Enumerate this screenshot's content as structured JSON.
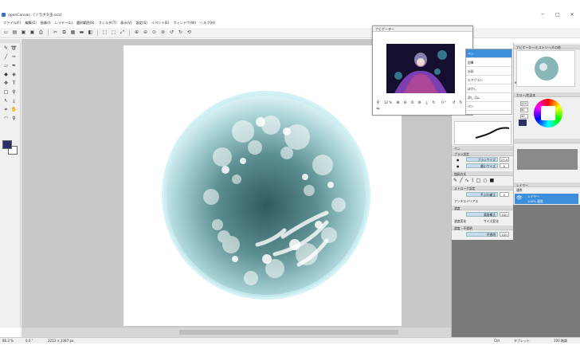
{
  "window": {
    "title": "openCanvas - [ソラボタ玉.ocz]",
    "minimize": "─",
    "maximize": "□",
    "close": "✕"
  },
  "menu": [
    "ファイル(F)",
    "編集(E)",
    "画像(I)",
    "レイヤー(L)",
    "選択範囲(S)",
    "フィルタ(T)",
    "表示(V)",
    "設定(S)",
    "イベント(E)",
    "ウィンドウ(W)",
    "ヘルプ(H)"
  ],
  "toolbar": {
    "icons": [
      "new-file-icon",
      "open-icon",
      "save-icon",
      "save-as-icon",
      "print-icon",
      "cut-icon",
      "copy-icon",
      "paste-icon",
      "delete-icon",
      "fill-icon",
      "select-all-icon",
      "deselect-icon",
      "transform-icon",
      "zoom-in-icon",
      "zoom-out-icon",
      "zoom-fit-icon",
      "zoom-actual-icon",
      "rotate-left-icon",
      "rotate-right-icon",
      "reset-rotation-icon"
    ]
  },
  "navigator": {
    "title": "ナビゲーター",
    "zoom": "12 %",
    "rotation": "0 °"
  },
  "tool_property": {
    "title": "ペン",
    "brush_section": "ブラシ設定",
    "size_label": "ブラシサイズ",
    "size_value": "27.0",
    "min_size_label": "最小サイズ",
    "min_size_value": "0",
    "shape_section": "描画方式",
    "stroke_section": "ストローク設定",
    "stroke_label": "手ぶれ補正",
    "stroke_value": "0",
    "antialias": "アンチエイリアス",
    "density_section": "濃度",
    "density_label": "濃度補正",
    "density_value": "100",
    "density_toggle": "濃度変化",
    "size_toggle": "サイズ変化",
    "opacity_section": "濃度・不透明",
    "opacity_label": "不透明",
    "opacity_value": "100"
  },
  "right_panel": {
    "tab_title": "ナビゲーター/ヒストリー/その他",
    "color_title": "カラー/色見本",
    "hsv_h": "220",
    "hsv_s": "60",
    "hsv_v": "40",
    "layer_tab": "レイヤー",
    "layer_mode": "通常",
    "layer_name": "レイヤー",
    "layer_opacity": "100% 通常",
    "zoom_readout": "86 %"
  },
  "brush_popup": {
    "items": [
      "ペン",
      "鉛筆",
      "水彩",
      "エアブラシ",
      "ぼかし",
      "消しゴム",
      "ぺン"
    ]
  },
  "status": {
    "zoom": "86.3 %",
    "rotation": "0.0 °",
    "size": "2253 × 2387 px",
    "right_info1": "Ctrl",
    "right_info2": "タブレット",
    "right_info3": "100 階調"
  },
  "colors": {
    "accent": "#3d8edb",
    "fg_color": "#2b2e66",
    "bg_color": "#ffffff"
  }
}
